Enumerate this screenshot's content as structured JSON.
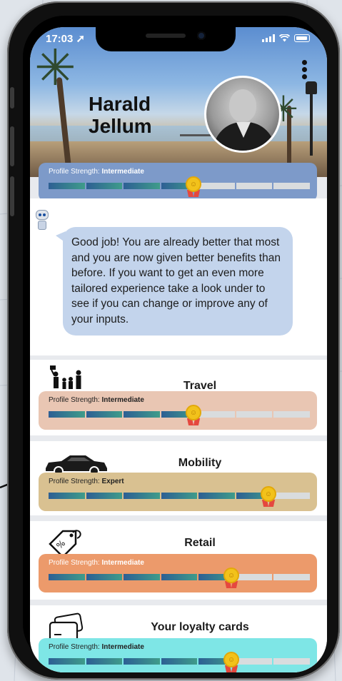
{
  "status_bar": {
    "time": "17:03 ➚"
  },
  "profile": {
    "first_name": "Harald",
    "last_name": "Jellum",
    "strength": {
      "prefix": "Profile Strength: ",
      "level": "Intermediate",
      "filled_segments": 4,
      "total_segments": 7
    }
  },
  "assistant": {
    "message": "Good job! You are already better that most and you are now given better benefits than before. If you want to get an even more tailored experience take a look under to see if you can change or improve any of your inputs."
  },
  "categories": [
    {
      "title": "Travel",
      "icon": "family-icon",
      "strength_prefix": "Profile Strength: ",
      "level": "Intermediate",
      "filled_segments": 4,
      "total_segments": 7,
      "color": "#e9c6b3"
    },
    {
      "title": "Mobility",
      "icon": "car-icon",
      "strength_prefix": "Profile Strength: ",
      "level": "Expert",
      "filled_segments": 6,
      "total_segments": 7,
      "color": "#d9c191"
    },
    {
      "title": "Retail",
      "icon": "price-tag-icon",
      "strength_prefix": "Profile Strength: ",
      "level": "Intermediate",
      "filled_segments": 5,
      "total_segments": 7,
      "color": "#ec9a6b"
    },
    {
      "title": "Your loyalty cards",
      "icon": "cards-icon",
      "strength_prefix": "Profile Strength: ",
      "level": "Intermediate",
      "filled_segments": 5,
      "total_segments": 7,
      "color": "#7ee6e6"
    }
  ],
  "colors": {
    "profile_strength_box": "#7d9ac9",
    "bubble": "#c3d4ec",
    "progress": "#2d5f94",
    "medal": "#f2c21b"
  }
}
